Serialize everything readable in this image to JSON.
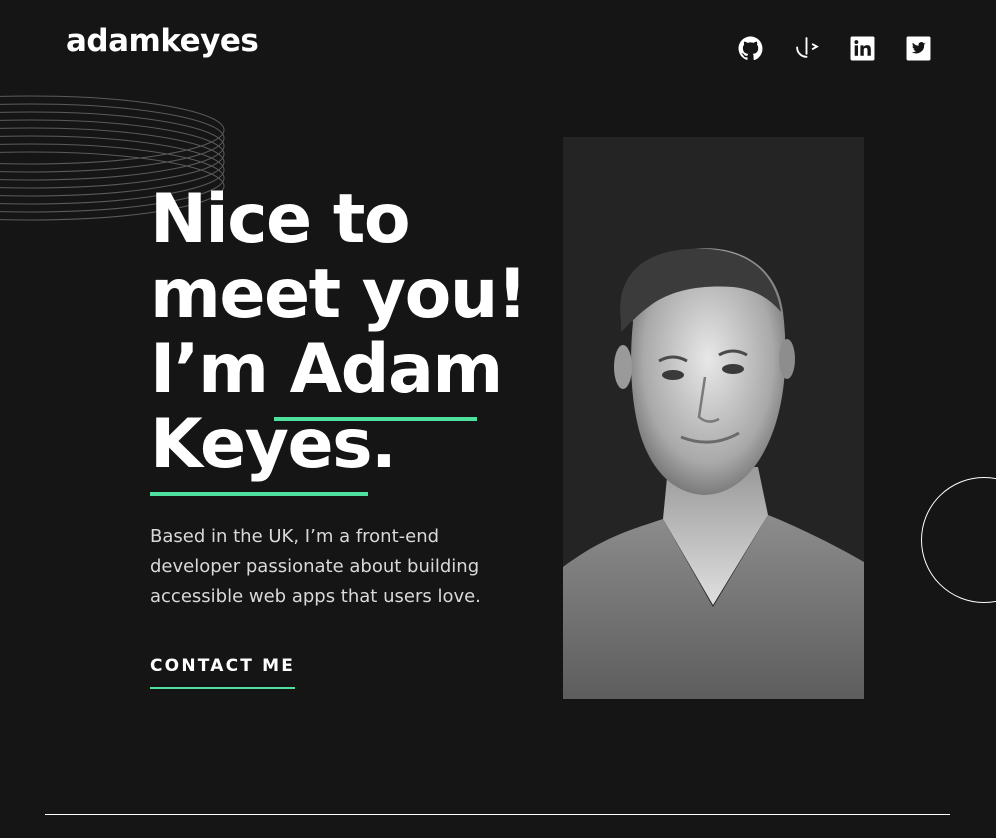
{
  "header": {
    "logo": "adamkeyes",
    "social": [
      {
        "name": "github-icon"
      },
      {
        "name": "frontend-mentor-icon"
      },
      {
        "name": "linkedin-icon"
      },
      {
        "name": "twitter-icon"
      }
    ]
  },
  "hero": {
    "headline_lines": [
      "Nice to",
      "meet you!",
      "I’m Adam",
      "Keyes."
    ],
    "intro": "Based in the UK, I’m a front-end developer passionate about building accessible web apps that users love.",
    "contact_label": "CONTACT ME"
  },
  "colors": {
    "background": "#151515",
    "accent": "#4ee1a0",
    "text": "#ffffff",
    "muted_text": "#d9d9d9"
  }
}
